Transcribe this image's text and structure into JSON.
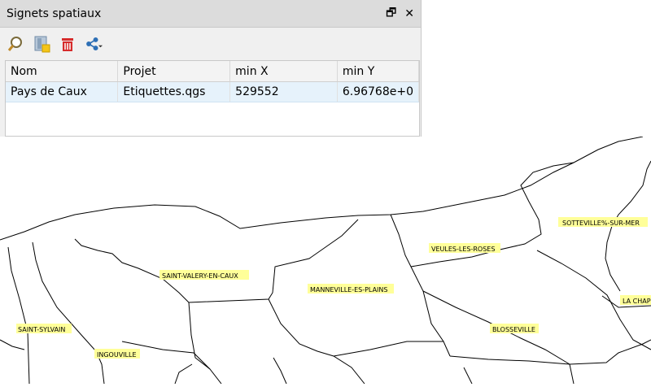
{
  "panel": {
    "title": "Signets spatiaux",
    "restore_glyph": "🗗",
    "close_glyph": "✕",
    "toolbar_icons": [
      "zoom-to-bookmark-icon",
      "new-bookmark-icon",
      "delete-bookmark-icon",
      "share-icon"
    ]
  },
  "table": {
    "headers": [
      "Nom",
      "Projet",
      "min X",
      "min Y"
    ],
    "rows": [
      [
        "Pays de Caux",
        "Etiquettes.qgs",
        "529552",
        "6.96768e+0"
      ]
    ]
  },
  "map": {
    "labels": {
      "sotteville": "SOTTEVILLE%-SUR-MER",
      "veules": "VEULES-LES-ROSES",
      "saint_valery": "SAINT-VALERY-EN-CAUX",
      "manneville": "MANNEVILLE-ES-PLAINS",
      "la_chap": "LA CHAP",
      "saint_sylvain": "SAINT-SYLVAIN",
      "blosseville": "BLOSSEVILLE",
      "ingouville": "INGOUVILLE"
    },
    "label_bg_color": "#ffff99"
  }
}
